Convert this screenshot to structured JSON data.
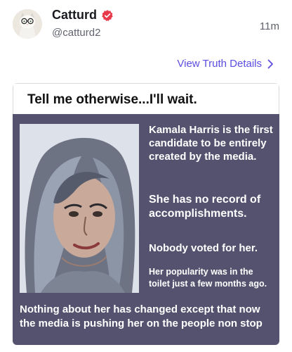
{
  "post": {
    "display_name": "Catturd",
    "handle": "@catturd2",
    "timestamp": "11m",
    "verified_icon": "verified-badge-icon",
    "colors": {
      "verified": "#e8394a",
      "link": "#5b4de0",
      "meme_bg": "#54526e"
    }
  },
  "details_link": {
    "label": "View Truth Details",
    "icon": "chevron-right-icon"
  },
  "meme": {
    "title": "Tell me otherwise...I'll wait.",
    "lines": [
      "Kamala Harris is the first candidate to be entirely created by the media.",
      "She has no record of accomplishments.",
      "Nobody voted for her.",
      "Her popularity was in the toilet just a few months ago.",
      "Nothing about her has changed except that now the media is pushing her on the people non stop"
    ]
  }
}
